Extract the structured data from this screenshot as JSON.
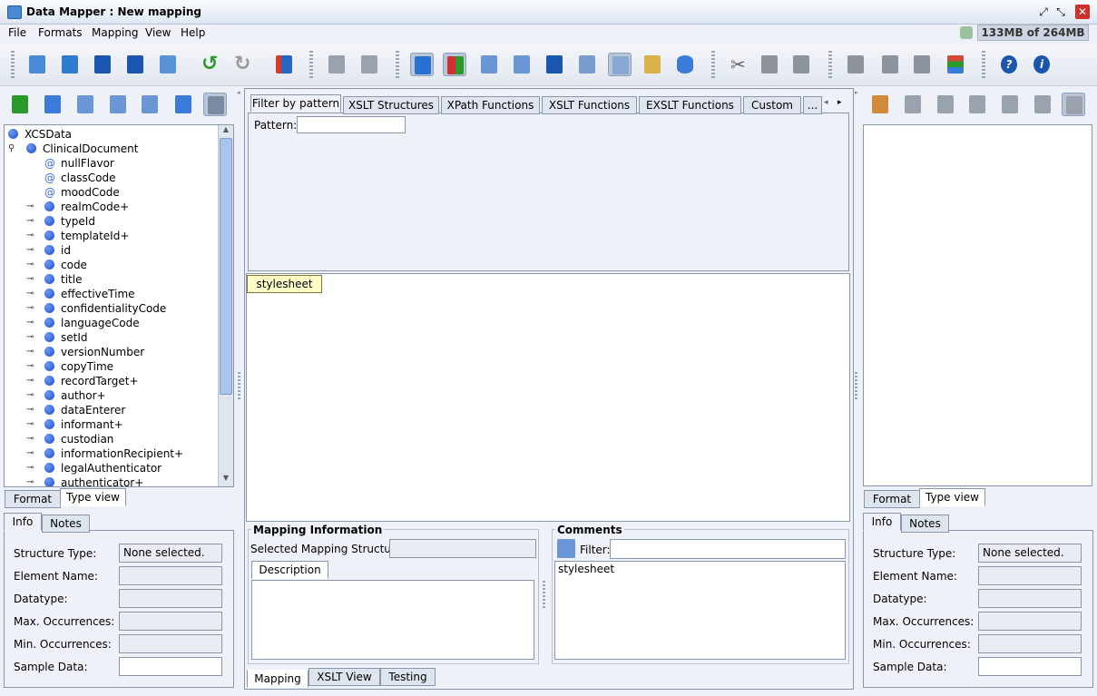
{
  "window": {
    "title": "Data Mapper : New mapping",
    "memory": "133MB of 264MB"
  },
  "menu": [
    "File",
    "Formats",
    "Mapping",
    "View",
    "Help"
  ],
  "left_tree": {
    "items": [
      {
        "label": "XCSData",
        "type": "root"
      },
      {
        "label": "ClinicalDocument",
        "type": "element-expanded"
      },
      {
        "label": "nullFlavor",
        "type": "attribute"
      },
      {
        "label": "classCode",
        "type": "attribute"
      },
      {
        "label": "moodCode",
        "type": "attribute"
      },
      {
        "label": "realmCode+",
        "type": "element"
      },
      {
        "label": "typeId",
        "type": "element"
      },
      {
        "label": "templateId+",
        "type": "element"
      },
      {
        "label": "id",
        "type": "element"
      },
      {
        "label": "code",
        "type": "element"
      },
      {
        "label": "title",
        "type": "element"
      },
      {
        "label": "effectiveTime",
        "type": "element"
      },
      {
        "label": "confidentialityCode",
        "type": "element"
      },
      {
        "label": "languageCode",
        "type": "element"
      },
      {
        "label": "setId",
        "type": "element"
      },
      {
        "label": "versionNumber",
        "type": "element"
      },
      {
        "label": "copyTime",
        "type": "element"
      },
      {
        "label": "recordTarget+",
        "type": "element"
      },
      {
        "label": "author+",
        "type": "element"
      },
      {
        "label": "dataEnterer",
        "type": "element"
      },
      {
        "label": "informant+",
        "type": "element"
      },
      {
        "label": "custodian",
        "type": "element"
      },
      {
        "label": "informationRecipient+",
        "type": "element"
      },
      {
        "label": "legalAuthenticator",
        "type": "element"
      },
      {
        "label": "authenticator+",
        "type": "element"
      }
    ]
  },
  "left_view_tabs": [
    "Format",
    "Type view"
  ],
  "info_tabs": [
    "Info",
    "Notes"
  ],
  "info_fields": {
    "labels": [
      "Structure Type:",
      "Element Name:",
      "Datatype:",
      "Max. Occurrences:",
      "Min. Occurrences:",
      "Sample Data:"
    ],
    "structure_type_value": "None selected."
  },
  "center": {
    "top_tabs": [
      "Filter by pattern",
      "XSLT Structures",
      "XPath Functions",
      "XSLT Functions",
      "EXSLT Functions",
      "Custom",
      "..."
    ],
    "pattern_label": "Pattern:",
    "stylesheet_node": "stylesheet",
    "mapping_info": {
      "title": "Mapping Information",
      "selected_label": "Selected Mapping Structure:",
      "description_tab": "Description"
    },
    "comments": {
      "title": "Comments",
      "filter_label": "Filter:",
      "items": [
        "stylesheet"
      ]
    },
    "bottom_tabs": [
      "Mapping",
      "XSLT View",
      "Testing"
    ]
  }
}
